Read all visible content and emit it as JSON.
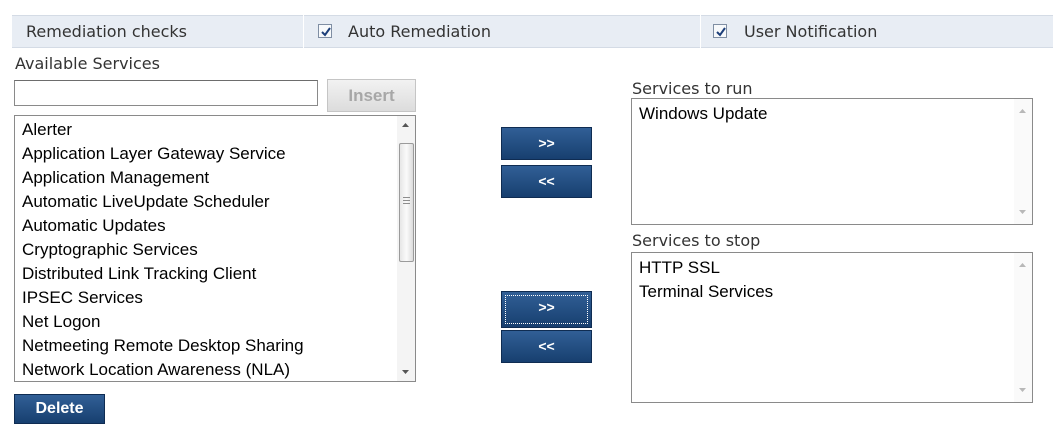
{
  "header": {
    "title": "Remediation checks",
    "auto_remediation": {
      "label": "Auto Remediation",
      "checked": true
    },
    "user_notification": {
      "label": "User Notification",
      "checked": true
    }
  },
  "available": {
    "label": "Available Services",
    "search_value": "",
    "insert_label": "Insert",
    "items": [
      "Alerter",
      "Application Layer Gateway Service",
      "Application Management",
      "Automatic LiveUpdate Scheduler",
      "Automatic Updates",
      "Cryptographic Services",
      "Distributed Link Tracking Client",
      "IPSEC Services",
      "Net Logon",
      "Netmeeting Remote Desktop Sharing",
      "Network Location Awareness (NLA)"
    ],
    "delete_label": "Delete"
  },
  "run": {
    "label": "Services to run",
    "items": [
      "Windows Update"
    ],
    "add_label": ">>",
    "remove_label": "<<"
  },
  "stop": {
    "label": "Services to stop",
    "items": [
      "HTTP SSL",
      "Terminal Services"
    ],
    "add_label": ">>",
    "remove_label": "<<"
  },
  "colors": {
    "header_bg": "#e8edf4",
    "button_blue": "#1f4a7e"
  }
}
